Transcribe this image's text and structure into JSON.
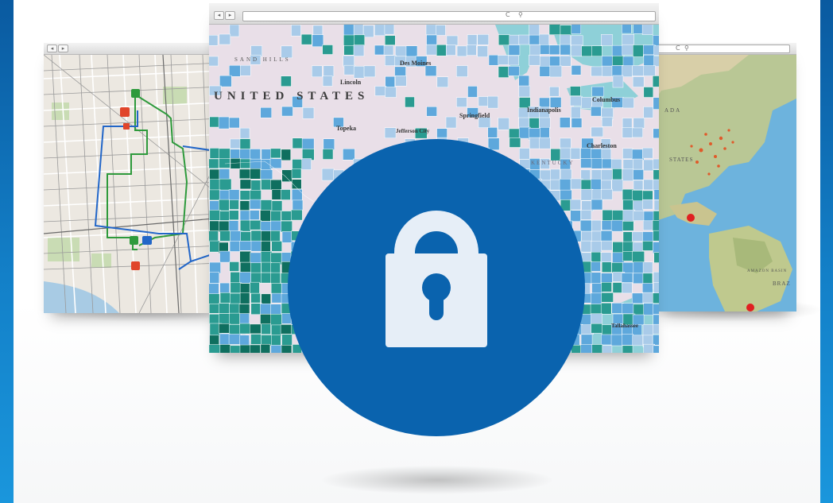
{
  "left_browser": {
    "map_kind": "street-transit-map",
    "route_colors": [
      "#2e9a3c",
      "#2266c8"
    ]
  },
  "center_browser": {
    "reload_icon": "C",
    "search_icon": "magnifier",
    "map_kind": "county-choropleth-map",
    "labels": {
      "country": "UNITED STATES",
      "sand_hills": "SAND HILLS",
      "des_moines": "Des Moines",
      "lincoln": "Lincoln",
      "springfield": "Springfield",
      "indianapolis": "Indianapolis",
      "jefferson_city": "Jefferson City",
      "topeka": "Topeka",
      "charleston": "Charleston",
      "kentucky": "KENTUCKY",
      "columbus": "Columbus",
      "tallahassee": "Tallahassee"
    },
    "colors": {
      "land": "#e9dfe8",
      "light": "#a9cbe9",
      "mid": "#5ea8dc",
      "teal": "#2a9b91",
      "dark_teal": "#0f6f5f"
    }
  },
  "right_browser": {
    "reload_icon": "C",
    "search_icon": "magnifier",
    "map_kind": "world-physical-map",
    "labels": {
      "canada": "ADA",
      "states": "STATES",
      "amazon": "AMAZON BASIN",
      "brazil": "BRAZ"
    }
  },
  "badge": {
    "icon": "padlock-icon",
    "color": "#0a63ae",
    "glyph_color": "#e6eef7"
  }
}
